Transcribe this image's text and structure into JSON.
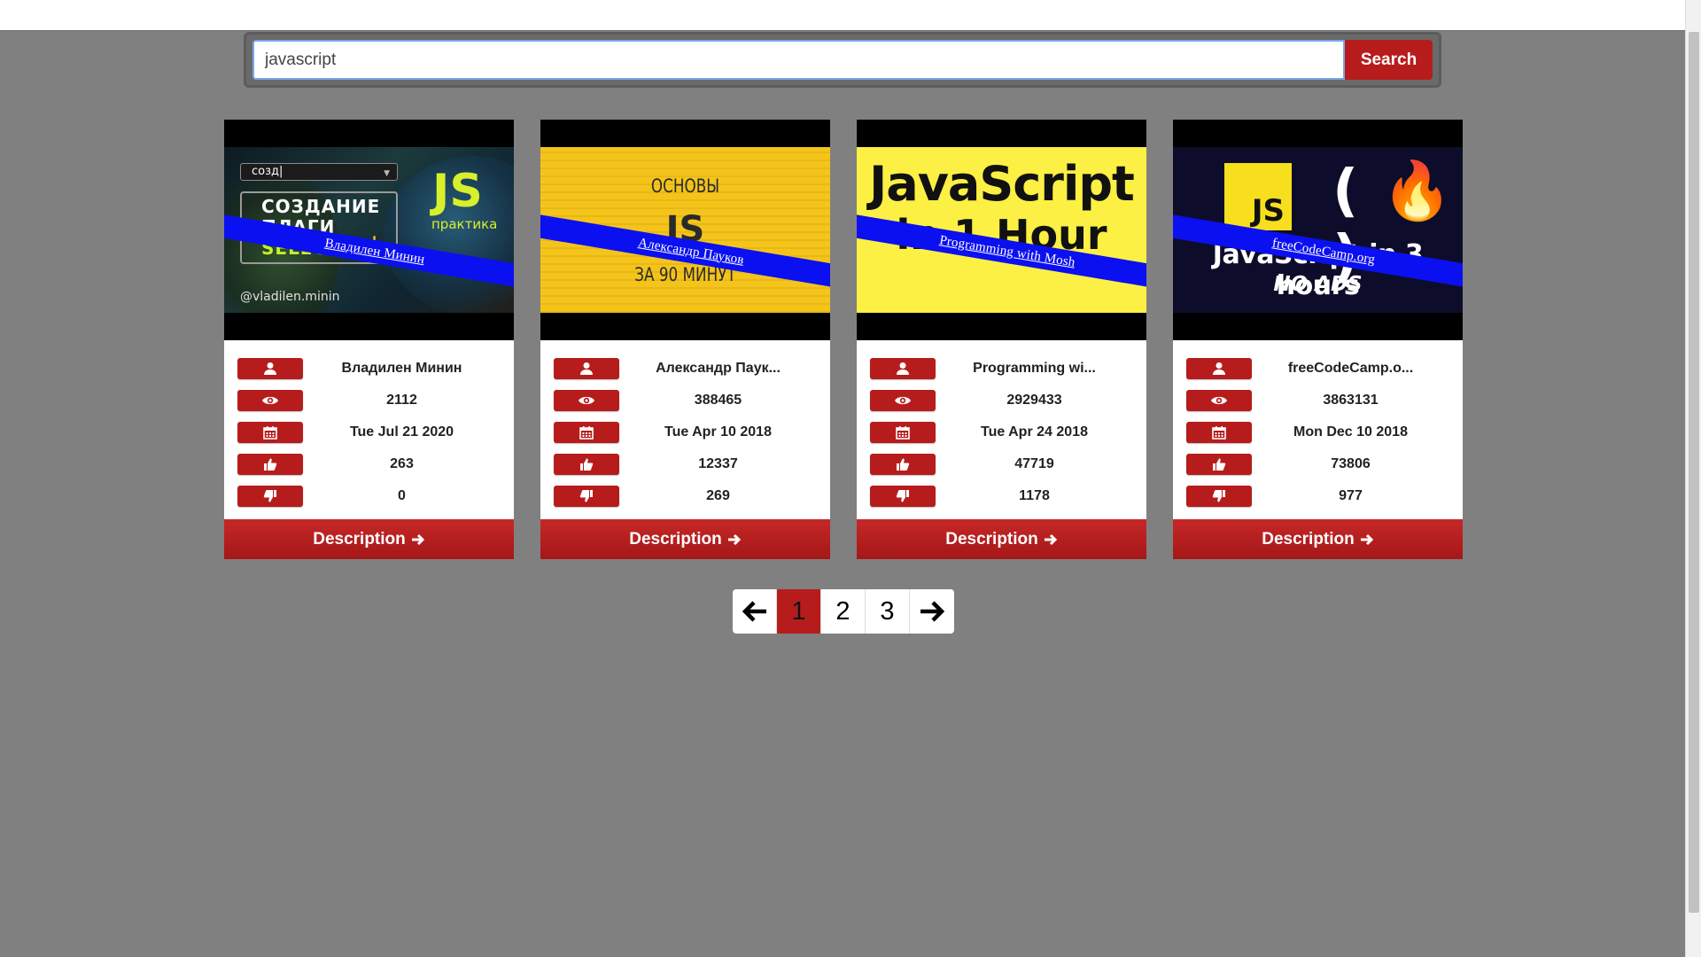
{
  "search": {
    "value": "javascript",
    "button_label": "Search"
  },
  "colors": {
    "accent": "#b71c1c",
    "background": "#808080",
    "ribbon": "#0b10f0"
  },
  "icons": {
    "author": "user-icon",
    "views": "eye-icon",
    "date": "calendar-icon",
    "likes": "thumbs-up-icon",
    "dislikes": "thumbs-down-icon",
    "description": "arrow-right-icon"
  },
  "videos": [
    {
      "ribbon": "Владилен Минин",
      "thumb": {
        "dropdown": "созд|",
        "line1": "СОЗДАНИЕ",
        "line2": "ПЛАГИ",
        "line3": "SELECT",
        "js": "JS",
        "tag": "практика",
        "handle": "@vladilen.minin"
      },
      "author": "Владилен Минин",
      "views": "2112",
      "date": "Tue Jul 21 2020",
      "likes": "263",
      "dislikes": "0",
      "description_label": "Description"
    },
    {
      "ribbon": "Александр Пауков",
      "thumb": {
        "line1": "ОСНОВЫ",
        "js": "JS",
        "line3": "ЗА 90 МИНУТ"
      },
      "author": "Александр Паук...",
      "views": "388465",
      "date": "Tue Apr 10 2018",
      "likes": "12337",
      "dislikes": "269",
      "description_label": "Description"
    },
    {
      "ribbon": "Programming with Mosh",
      "thumb": {
        "line1": "JavaScript",
        "line2": "in 1 Hour"
      },
      "author": "Programming wi...",
      "views": "2929433",
      "date": "Tue Apr 24 2018",
      "likes": "47719",
      "dislikes": "1178",
      "description_label": "Description"
    },
    {
      "ribbon": "freeCodeCamp.org",
      "thumb": {
        "js": "JS",
        "logo": "( 🔥 )",
        "line1": "JavaScript in 3 hours",
        "line2": "NO ADS"
      },
      "author": "freeCodeCamp.o...",
      "views": "3863131",
      "date": "Mon Dec 10 2018",
      "likes": "73806",
      "dislikes": "977",
      "description_label": "Description"
    }
  ],
  "pagination": {
    "prev_icon": "arrow-left-icon",
    "next_icon": "arrow-right-icon",
    "pages": [
      "1",
      "2",
      "3"
    ],
    "current": "1"
  }
}
